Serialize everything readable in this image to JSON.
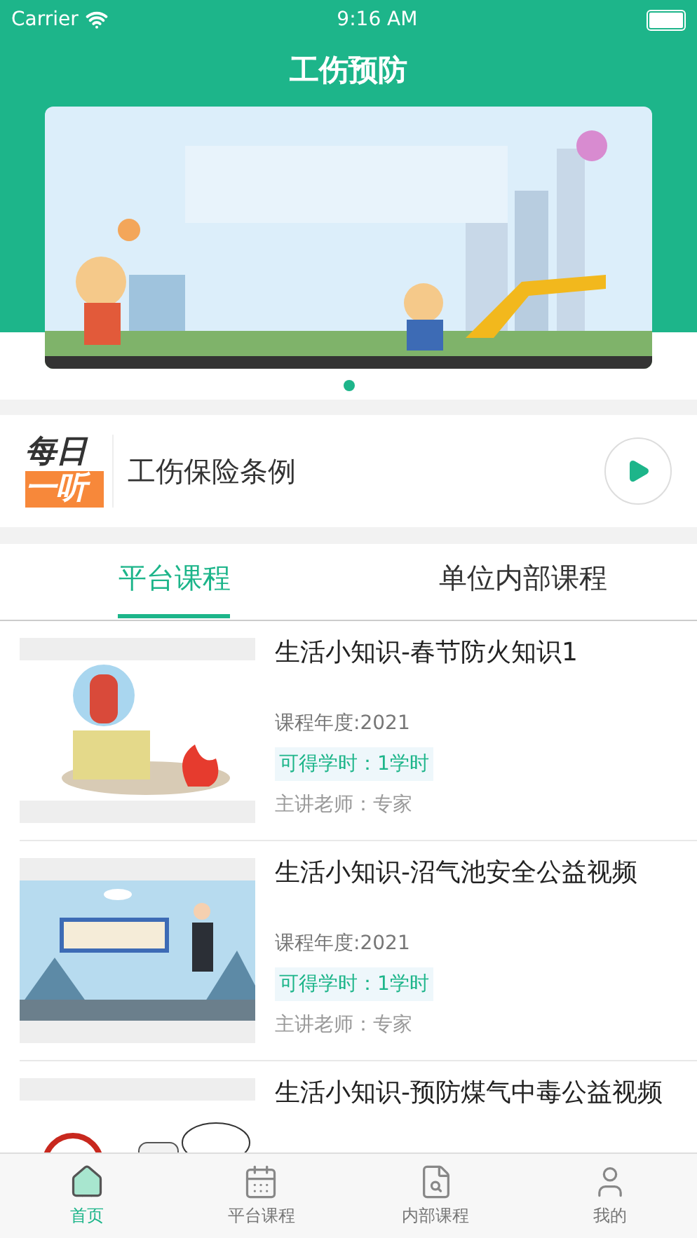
{
  "status_bar": {
    "carrier": "Carrier",
    "time": "9:16 AM"
  },
  "header": {
    "title": "工伤预防"
  },
  "daily": {
    "logo_top": "每日",
    "logo_bottom": "一听",
    "title": "工伤保险条例"
  },
  "tabs": [
    {
      "label": "平台课程",
      "selected": true
    },
    {
      "label": "单位内部课程",
      "selected": false
    }
  ],
  "courses": [
    {
      "title": "生活小知识-春节防火知识1",
      "year": "课程年度:2021",
      "hours": "可得学时：1学时",
      "teacher": "主讲老师：专家"
    },
    {
      "title": "生活小知识-沼气池安全公益视频",
      "year": "课程年度:2021",
      "hours": "可得学时：1学时",
      "teacher": "主讲老师：专家"
    },
    {
      "title": "生活小知识-预防煤气中毒公益视频"
    }
  ],
  "tab_bar": [
    {
      "label": "首页",
      "kind": "home",
      "selected": true
    },
    {
      "label": "平台课程",
      "kind": "calendar",
      "selected": false
    },
    {
      "label": "内部课程",
      "kind": "document",
      "selected": false
    },
    {
      "label": "我的",
      "kind": "profile",
      "selected": false
    }
  ]
}
